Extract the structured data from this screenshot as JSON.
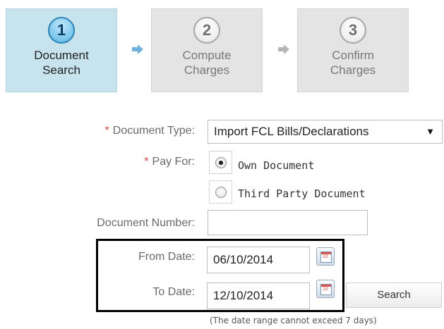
{
  "wizard": {
    "steps": [
      {
        "number": "1",
        "label": "Document Search",
        "active": true
      },
      {
        "number": "2",
        "label": "Compute Charges",
        "active": false
      },
      {
        "number": "3",
        "label": "Confirm Charges",
        "active": false
      }
    ],
    "arrow_icon": "arrow-right-icon",
    "active_arrow_color": "#6fb3dc",
    "inactive_arrow_color": "#b5b5b5"
  },
  "form": {
    "required_marker": "*",
    "document_type": {
      "label": "Document Type:",
      "value": "Import FCL Bills/Declarations",
      "caret": "▼"
    },
    "pay_for": {
      "label": "Pay For:",
      "options": [
        {
          "label": "Own Document",
          "checked": true
        },
        {
          "label": "Third Party Document",
          "checked": false
        }
      ]
    },
    "document_number": {
      "label": "Document Number:",
      "value": ""
    },
    "from_date": {
      "label": "From Date:",
      "value": "06/10/2014",
      "calendar_text": "10"
    },
    "to_date": {
      "label": "To Date:",
      "value": "12/10/2014",
      "calendar_text": "10"
    },
    "search_button": "Search",
    "note": "(The date range cannot exceed 7 days)"
  },
  "colors": {
    "active_step_bg": "#c6e3ee",
    "inactive_step_bg": "#e4e4e4",
    "required_marker": "#d0453a",
    "highlight_border": "#000000"
  }
}
